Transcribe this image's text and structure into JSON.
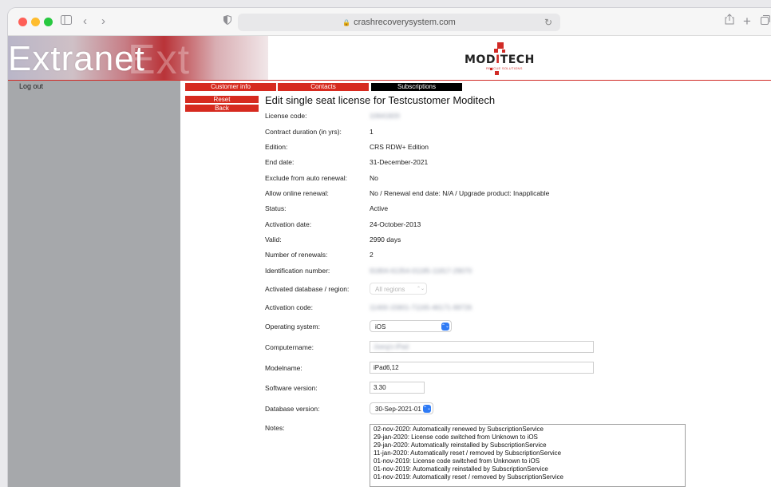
{
  "browser": {
    "url": "crashrecoverysystem.com",
    "icons": [
      "sidebar-icon",
      "back-icon",
      "forward-icon",
      "shield-icon",
      "lock-icon",
      "reload-icon",
      "share-icon",
      "new-tab-icon",
      "tabs-overview-icon"
    ]
  },
  "banner": {
    "title": "Extranet",
    "ghost_text": "Ext",
    "logo_word_pre": "MOD",
    "logo_word_i": "I",
    "logo_word_post": "TECH",
    "logo_sub": "RESCUE SOLUTIONS"
  },
  "sidebar": {
    "logout": "Log out"
  },
  "tabs": [
    {
      "label": "Customer info"
    },
    {
      "label": "Contacts"
    },
    {
      "label": "Subscriptions"
    }
  ],
  "actions": {
    "reset": "Reset",
    "back": "Back"
  },
  "page": {
    "title": "Edit single seat license for Testcustomer Moditech"
  },
  "fields": {
    "license_code": {
      "label": "License code:",
      "value": "10641820"
    },
    "contract_duration": {
      "label": "Contract duration (in yrs):",
      "value": "1"
    },
    "edition": {
      "label": "Edition:",
      "value": "CRS RDW+ Edition"
    },
    "end_date": {
      "label": "End date:",
      "value": "31-December-2021"
    },
    "exclude_auto_renewal": {
      "label": "Exclude from auto renewal:",
      "value": "No"
    },
    "allow_online_renewal": {
      "label": "Allow online renewal:",
      "value": "No / Renewal end date: N/A / Upgrade product: Inapplicable"
    },
    "status": {
      "label": "Status:",
      "value": "Active"
    },
    "activation_date": {
      "label": "Activation date:",
      "value": "24-October-2013"
    },
    "valid": {
      "label": "Valid:",
      "value": "2990 days"
    },
    "number_of_renewals": {
      "label": "Number of renewals:",
      "value": "2"
    },
    "identification_number": {
      "label": "Identification number:",
      "value": "91804-61354-01185-11817-29070"
    },
    "activated_database": {
      "label": "Activated database / region:",
      "value": "All regions"
    },
    "activation_code": {
      "label": "Activation code:",
      "value": "11400-15901-71165-46171-99726"
    },
    "operating_system": {
      "label": "Operating system:",
      "value": "iOS"
    },
    "computername": {
      "label": "Computername:",
      "value": "Joerg's iPad"
    },
    "modelname": {
      "label": "Modelname:",
      "value": "iPad6,12"
    },
    "software_version": {
      "label": "Software version:",
      "value": "3.30"
    },
    "database_version": {
      "label": "Database version:",
      "value": "30-Sep-2021-01"
    },
    "notes": {
      "label": "Notes:",
      "lines": [
        "02-nov-2020: Automatically renewed by SubscriptionService",
        "29-jan-2020: License code switched from Unknown to iOS",
        "29-jan-2020: Automatically reinstalled by SubscriptionService",
        "11-jan-2020: Automatically reset / removed by SubscriptionService",
        "01-nov-2019: License code switched from Unknown to iOS",
        "01-nov-2019: Automatically reinstalled by SubscriptionService",
        "01-nov-2019: Automatically reset / removed by SubscriptionService"
      ]
    }
  },
  "colors": {
    "accent_red": "#d62a1f",
    "sidebar_gray": "#a6a8ab",
    "select_blue": "#2f7bf5"
  }
}
